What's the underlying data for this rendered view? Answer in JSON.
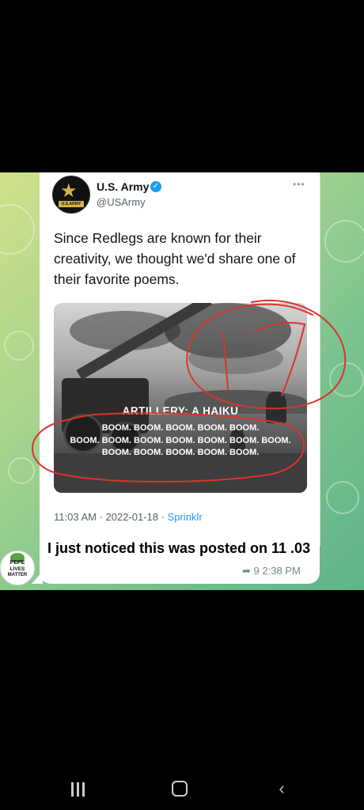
{
  "tweet": {
    "account_name": "U.S. Army",
    "handle": "@USArmy",
    "logo_text": "U.S.ARMY",
    "text": "Since Redlegs are known for their creativity, we thought we'd share one of their favorite poems.",
    "timestamp": "11:03 AM · 2022-01-18 · ",
    "source": "Sprinklr",
    "more_icon": "more-dots-icon",
    "verified_icon": "verified-check-icon"
  },
  "image": {
    "title": "ARTILLERY: A HAIKU",
    "line1": "BOOM. BOOM. BOOM. BOOM. BOOM.",
    "line2": "BOOM. BOOM. BOOM. BOOM. BOOM. BOOM. BOOM.",
    "line3": "BOOM. BOOM. BOOM. BOOM. BOOM.",
    "annotation": "17",
    "annotation_color": "#d9352b"
  },
  "message": {
    "text": "I just noticed this was posted on 11 .03",
    "reply_count": "9",
    "time": "2:38 PM",
    "reply_icon": "reply-arrow-icon"
  },
  "avatar": {
    "line1": "PEPE",
    "line2": "LIVES",
    "line3": "MATTER"
  },
  "navbar": {
    "recents_icon": "recents-icon",
    "home_icon": "home-icon",
    "back_icon": "back-chevron-icon"
  }
}
